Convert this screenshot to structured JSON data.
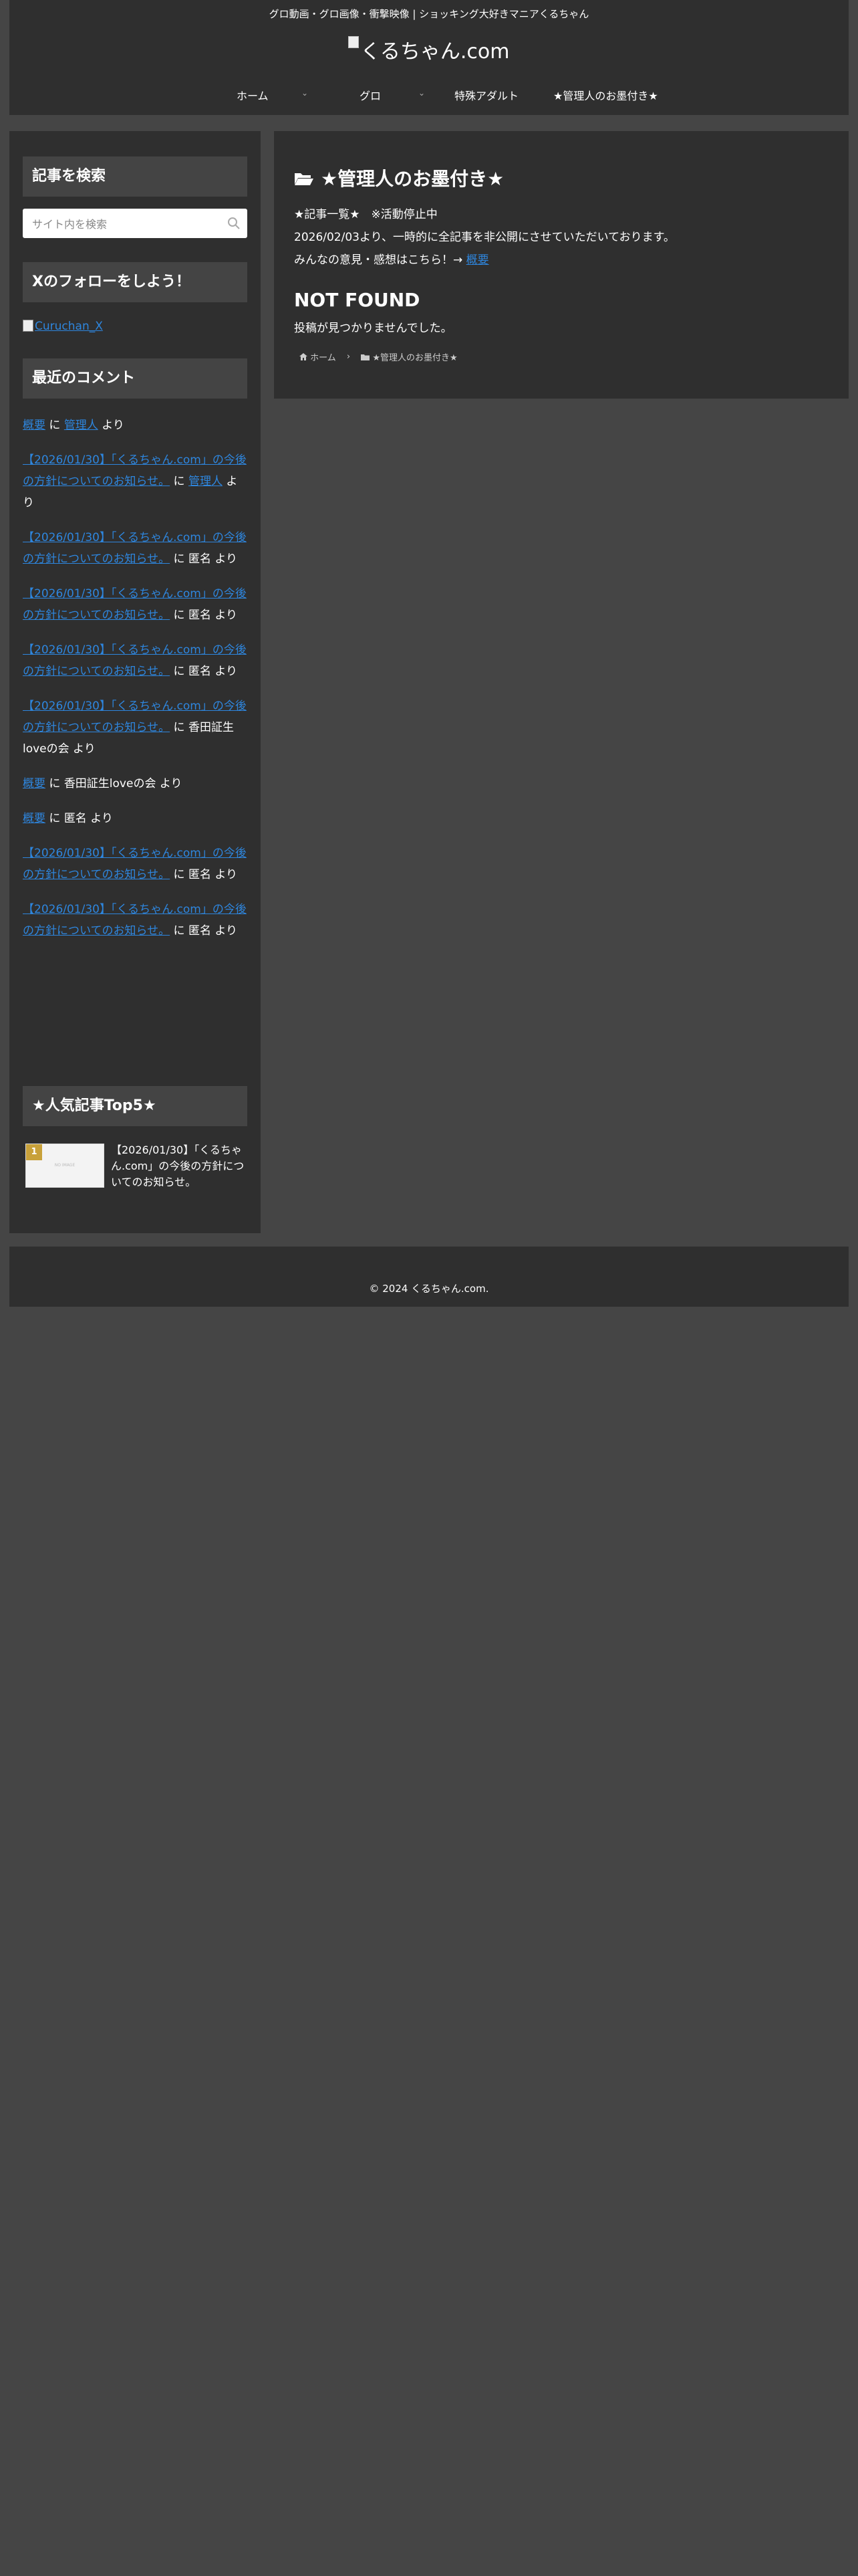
{
  "header": {
    "tagline": "グロ動画・グロ画像・衝撃映像 | ショッキング大好きマニアくるちゃん",
    "logo_text": "くるちゃん.com",
    "nav": [
      {
        "label": "ホーム",
        "has_dropdown": true
      },
      {
        "label": "グロ",
        "has_dropdown": true
      },
      {
        "label": "特殊アダルト",
        "has_dropdown": false
      },
      {
        "label": "★管理人のお墨付き★",
        "has_dropdown": false
      }
    ],
    "dropdown_icon": "chevron-down-icon"
  },
  "sidebar": {
    "search": {
      "title": "記事を検索",
      "placeholder": "サイト内を検索",
      "icon": "search-icon"
    },
    "follow": {
      "title": "Xのフォローをしよう！",
      "image_alt": "Curuchan_X"
    },
    "recent_comments": {
      "title": "最近のコメント",
      "items": [
        {
          "post": "概要",
          "connector": " に ",
          "author": "管理人",
          "author_link": true,
          "suffix": " より"
        },
        {
          "post": "【2026/01/30】「くるちゃん.com」の今後の方針についてのお知らせ。",
          "connector": " に ",
          "author": "管理人",
          "author_link": true,
          "suffix": " より"
        },
        {
          "post": "【2026/01/30】「くるちゃん.com」の今後の方針についてのお知らせ。",
          "connector": " に ",
          "author": "匿名",
          "author_link": false,
          "suffix": " より"
        },
        {
          "post": "【2026/01/30】「くるちゃん.com」の今後の方針についてのお知らせ。",
          "connector": " に ",
          "author": "匿名",
          "author_link": false,
          "suffix": " より"
        },
        {
          "post": "【2026/01/30】「くるちゃん.com」の今後の方針についてのお知らせ。",
          "connector": " に ",
          "author": "匿名",
          "author_link": false,
          "suffix": " より"
        },
        {
          "post": "【2026/01/30】「くるちゃん.com」の今後の方針についてのお知らせ。",
          "connector": " に ",
          "author": "香田証生loveの会",
          "author_link": false,
          "suffix": " より"
        },
        {
          "post": "概要",
          "connector": " に ",
          "author": "香田証生loveの会",
          "author_link": false,
          "suffix": " より"
        },
        {
          "post": "概要",
          "connector": " に ",
          "author": "匿名",
          "author_link": false,
          "suffix": " より"
        },
        {
          "post": "【2026/01/30】「くるちゃん.com」の今後の方針についてのお知らせ。",
          "connector": " に ",
          "author": "匿名",
          "author_link": false,
          "suffix": " より"
        },
        {
          "post": "【2026/01/30】「くるちゃん.com」の今後の方針についてのお知らせ。",
          "connector": " に ",
          "author": "匿名",
          "author_link": false,
          "suffix": " より"
        }
      ]
    },
    "popular": {
      "title": "★人気記事Top5★",
      "items": [
        {
          "rank": "1",
          "thumb_text": "NO IMAGE",
          "title": "【2026/01/30】「くるちゃん.com」の今後の方針についてのお知らせ。"
        }
      ]
    }
  },
  "main": {
    "title": "★管理人のお墨付き★",
    "title_icon": "folder-open-icon",
    "desc_line1": "★記事一覧★　※活動停止中",
    "desc_line2": "2026/02/03より、一時的に全記事を非公開にさせていただいております。",
    "desc_line3_prefix": "みんなの意見・感想はこちら！→ ",
    "desc_line3_link": "概要",
    "not_found_heading": "NOT FOUND",
    "not_found_text": "投稿が見つかりませんでした。",
    "breadcrumb": {
      "home": "ホーム",
      "home_icon": "home-icon",
      "separator": "›",
      "current": "★管理人のお墨付き★",
      "current_icon": "folder-icon"
    }
  },
  "footer": {
    "copyright": "© 2024 くるちゃん.com."
  },
  "colors": {
    "page_bg": "#454545",
    "panel_bg": "#2f2f2f",
    "widget_title_bg": "#444444",
    "link": "#2e86de",
    "rank_badge": "#c8a13a"
  }
}
